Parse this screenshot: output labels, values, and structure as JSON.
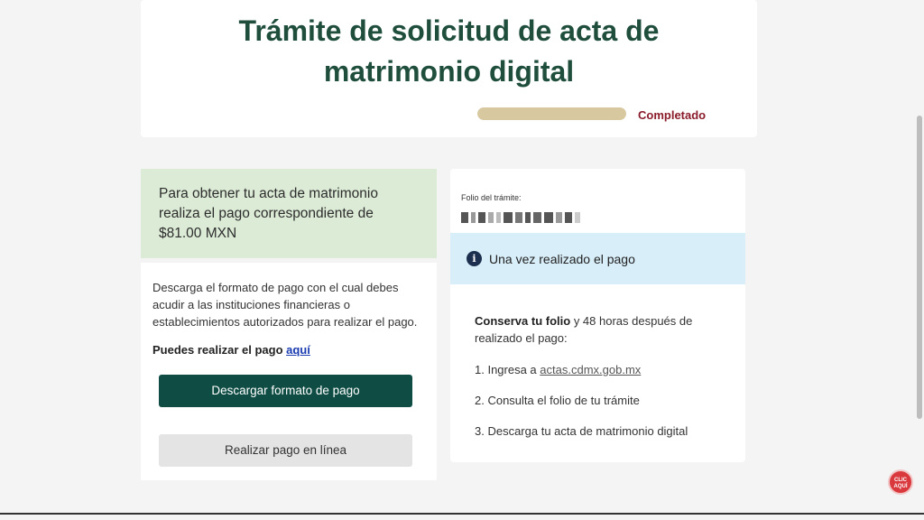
{
  "header": {
    "title_line1": "Trámite de solicitud de acta de",
    "title_line2": "matrimonio digital",
    "progress_label": "Completado",
    "progress_percent": 100
  },
  "payment": {
    "intro_line1": "Para obtener tu acta de matrimonio",
    "intro_line2": "realiza el pago correspondiente de",
    "amount": "$81.00 MXN",
    "desc_line1": "Descarga el formato de pago con el cual debes",
    "desc_line2": "acudir a las instituciones financieras o",
    "desc_line3": "establecimientos autorizados para realizar el pago.",
    "pay_here_text": "Puedes realizar el pago",
    "pay_here_link": "aquí",
    "download_button": "Descargar formato de pago",
    "online_button": "Realizar pago en línea"
  },
  "folio": {
    "label": "Folio del trámite:",
    "info_text": "Una vez realizado el pago",
    "keep_bold": "Conserva tu folio",
    "keep_line1": "y 48 horas después de",
    "keep_line2": "realizado el pago:",
    "step1_prefix": "1. Ingresa a",
    "step1_link": "actas.cdmx.gob.mx",
    "step2": "2. Consulta el folio de tu trámite",
    "step3": "3. Descarga tu acta de matrimonio digital"
  },
  "badge": {
    "line1": "CLIC",
    "line2": "AQUÍ"
  }
}
